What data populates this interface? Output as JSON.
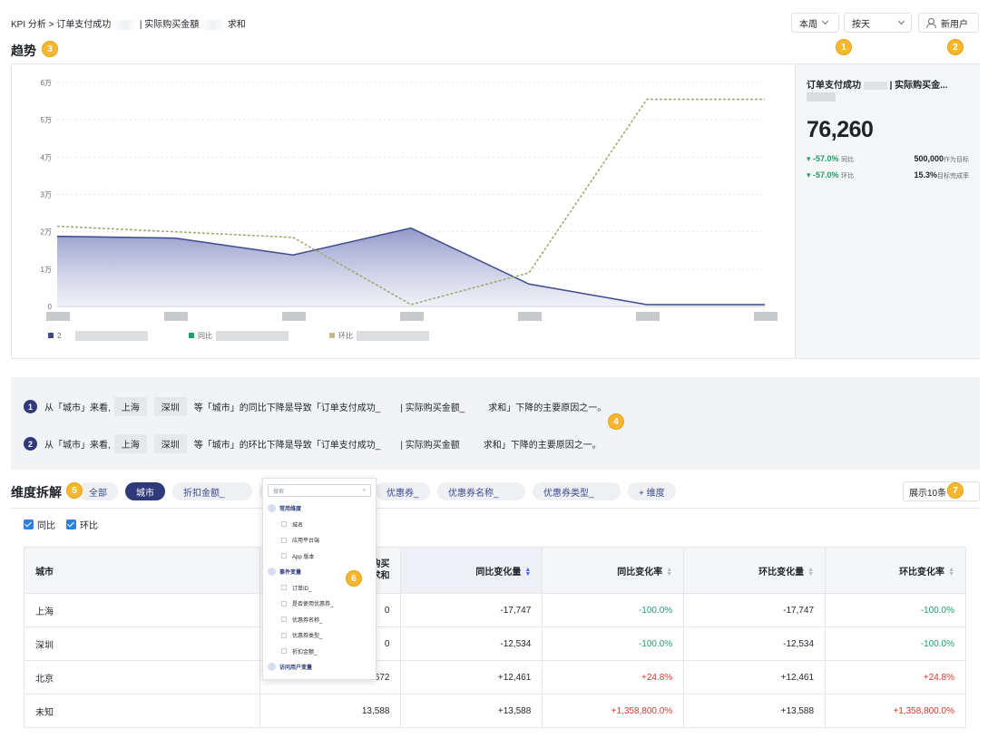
{
  "header": {
    "breadcrumb": "KPI 分析 > 订单支付成功",
    "breadcrumb_tail": "| 实际购买金額",
    "breadcrumb_end": "求和",
    "period_select": "本周",
    "granularity_select": "按天",
    "user_filter": "新用户"
  },
  "badges": {
    "b1": "1",
    "b2": "2",
    "b3": "3",
    "b4": "4",
    "b5": "5",
    "b6": "6",
    "b7": "7"
  },
  "trend": {
    "title": "趋势",
    "side": {
      "metric_title": "订单支付成功",
      "metric_title_tail": "| 实际购买金...",
      "value": "76,260",
      "yoy_change": "-57.0%",
      "yoy_label": "同比",
      "mom_change": "-57.0%",
      "mom_label": "环比",
      "target_value": "500,000",
      "target_label": "作为目标",
      "completion": "15.3%",
      "completion_label": "目标完成率"
    },
    "legend": {
      "current": "2",
      "yoy": "同比",
      "mom": "环比"
    }
  },
  "chart_data": {
    "type": "area",
    "y_ticks": [
      "6万",
      "5万",
      "4万",
      "3万",
      "2万",
      "1万",
      "0"
    ],
    "ylim": [
      0,
      60000
    ],
    "x_count": 7,
    "series": [
      {
        "values": [
          18800,
          18300,
          13800,
          21000,
          6000,
          500,
          500
        ]
      },
      {
        "name": "环比",
        "values": [
          21500,
          20000,
          18500,
          500,
          9000,
          55500,
          55500
        ]
      }
    ],
    "colors": {
      "area_stroke": "#3d4a8f",
      "area_fill_top": "#7f86c0",
      "area_fill_bottom": "#e6e8f4",
      "dashed": "#9aaa6a"
    }
  },
  "insight": {
    "row1": {
      "num": "1",
      "prefix": "从「城市」来看,",
      "tag1": "上海",
      "tag2": "深圳",
      "text": "等「城市」的同比下降是导致「订单支付成功_",
      "mid": "| 实际购买金额_",
      "suffix": "求和」下降的主要原因之一。"
    },
    "row2": {
      "num": "2",
      "prefix": "从「城市」来看,",
      "tag1": "上海",
      "tag2": "深圳",
      "text": "等「城市」的环比下降是导致「订单支付成功_",
      "mid": "| 实际购买金额",
      "suffix": "求和」下降的主要原因之一。"
    }
  },
  "dimension": {
    "title": "维度拆解",
    "chips": [
      "全部",
      "城市",
      "折扣金额_",
      "订",
      "优惠券_",
      "优惠券名称_",
      "优惠券类型_",
      "+ 维度"
    ],
    "show_select": "展示10条",
    "yoy_checkbox": "同比",
    "mom_checkbox": "环比"
  },
  "table": {
    "headers": [
      "城市",
      "购买\n求和",
      "同比变化量",
      "同比变化率",
      "环比变化量",
      "环比变化率"
    ],
    "header_col2_line1": "购买",
    "header_col2_line2": "求和",
    "rows": [
      {
        "city": "上海",
        "value": "0",
        "yoy_delta": "-17,747",
        "yoy_rate": "-100.0%",
        "mom_delta": "-17,747",
        "mom_rate": "-100.0%"
      },
      {
        "city": "深圳",
        "value": "0",
        "yoy_delta": "-12,534",
        "yoy_rate": "-100.0%",
        "mom_delta": "-12,534",
        "mom_rate": "-100.0%"
      },
      {
        "city": "北京",
        "value": "672",
        "yoy_delta": "+12,461",
        "yoy_rate": "+24.8%",
        "mom_delta": "+12,461",
        "mom_rate": "+24.8%"
      },
      {
        "city": "未知",
        "value": "13,588",
        "yoy_delta": "+13,588",
        "yoy_rate": "+1,358,800.0%",
        "mom_delta": "+13,588",
        "mom_rate": "+1,358,800.0%"
      }
    ]
  },
  "dropdown": {
    "search_placeholder": "搜索",
    "groups": [
      {
        "label": "常用维度",
        "items": [
          "城名",
          "应用平台端",
          "App 版本"
        ]
      },
      {
        "label": "事件变量",
        "items": [
          "订单ID_",
          "是否使用优惠券_",
          "优惠券名称_",
          "优惠券类型_",
          "折扣金额_"
        ]
      },
      {
        "label": "访问用户变量",
        "items": []
      }
    ]
  }
}
